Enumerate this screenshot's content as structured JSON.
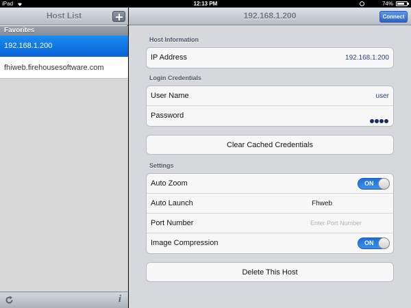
{
  "status_bar": {
    "carrier": "iPad",
    "time": "12:13 PM",
    "battery_percent": "74%",
    "battery_level": 0.74
  },
  "left_pane": {
    "title": "Host List",
    "section": "Favorites",
    "hosts": [
      {
        "label": "192.168.1.200",
        "selected": true
      },
      {
        "label": "fhiweb.firehousesoftware.com",
        "selected": false
      }
    ],
    "add_icon": "plus-icon",
    "refresh_icon": "refresh-icon",
    "info_label": "i"
  },
  "right_pane": {
    "title": "192.168.1.200",
    "connect_label": "Connect",
    "host_info": {
      "header": "Host Information",
      "ip_label": "IP Address",
      "ip_value": "192.168.1.200"
    },
    "login": {
      "header": "Login Credentials",
      "user_label": "User Name",
      "user_value": "user",
      "password_label": "Password",
      "password_masked": "••••"
    },
    "clear_label": "Clear Cached Credentials",
    "settings": {
      "header": "Settings",
      "auto_zoom_label": "Auto Zoom",
      "auto_zoom_state": "ON",
      "auto_launch_label": "Auto Launch",
      "auto_launch_value": "Fhweb",
      "port_label": "Port Number",
      "port_placeholder": "Enter Port Number",
      "image_compression_label": "Image Compression",
      "image_compression_state": "ON"
    },
    "delete_label": "Delete This Host"
  },
  "colors": {
    "selected_row": "#0a62d8",
    "toggle_on": "#2a7ee8",
    "connect_button": "#3a78d8"
  }
}
